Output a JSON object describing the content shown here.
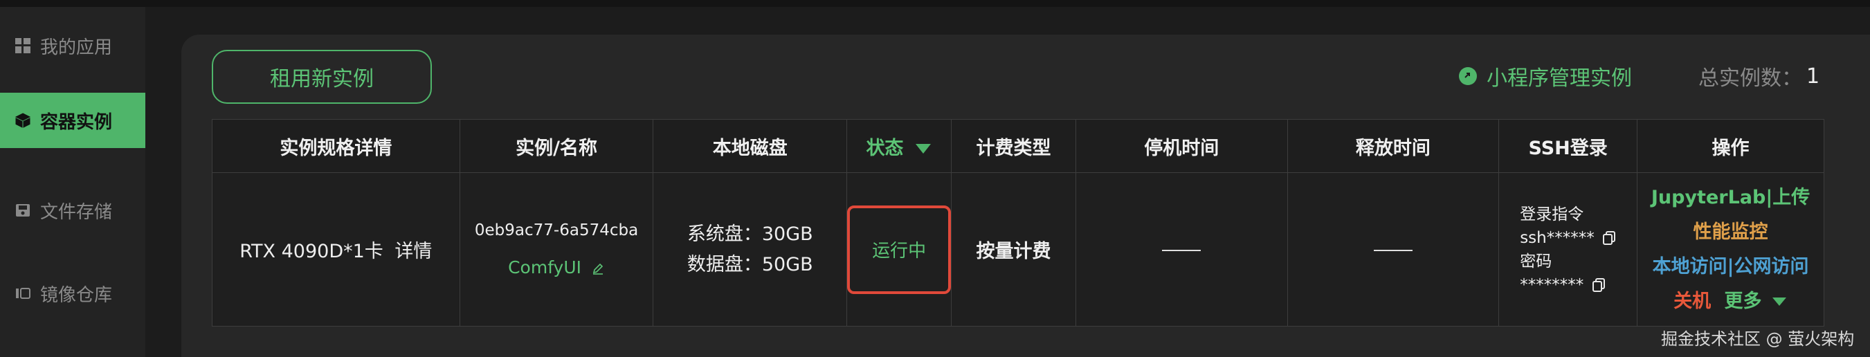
{
  "sidebar": {
    "items": [
      {
        "label": "我的应用",
        "icon": "grid-icon",
        "active": false
      },
      {
        "label": "容器实例",
        "icon": "cube-icon",
        "active": true
      },
      {
        "label": "文件存储",
        "icon": "disk-icon",
        "active": false
      },
      {
        "label": "镜像仓库",
        "icon": "image-icon",
        "active": false
      }
    ]
  },
  "header": {
    "rent_button": "租用新实例",
    "mini_manage": "小程序管理实例",
    "total_label": "总实例数：",
    "total_count": "1"
  },
  "table": {
    "columns": [
      "实例规格详情",
      "实例/名称",
      "本地磁盘",
      "状态",
      "计费类型",
      "停机时间",
      "释放时间",
      "SSH登录",
      "操作"
    ],
    "row": {
      "spec": "RTX 4090D*1卡",
      "spec_link": "详情",
      "instance_id": "0eb9ac77-6a574cba",
      "instance_name": "ComfyUI",
      "disk_system": "系统盘：30GB",
      "disk_data": "数据盘：50GB",
      "status": "运行中",
      "billing": "按量计费",
      "ssh_cmd_label": "登录指令",
      "ssh_cmd_value": "ssh******",
      "ssh_pwd_label": "密码",
      "ssh_pwd_value": "********",
      "ops": {
        "jupyter": "JupyterLab",
        "upload": "上传",
        "monitor": "性能监控",
        "local_access": "本地访问",
        "public_access": "公网访问",
        "shutdown": "关机",
        "more": "更多"
      }
    }
  },
  "colors": {
    "accent": "#4fb56a",
    "status_border": "#e0493a",
    "monitor": "#e0a04a",
    "access": "#4ea1d3",
    "shutdown": "#e8583a"
  },
  "watermark": "掘金技术社区 @ 萤火架构"
}
